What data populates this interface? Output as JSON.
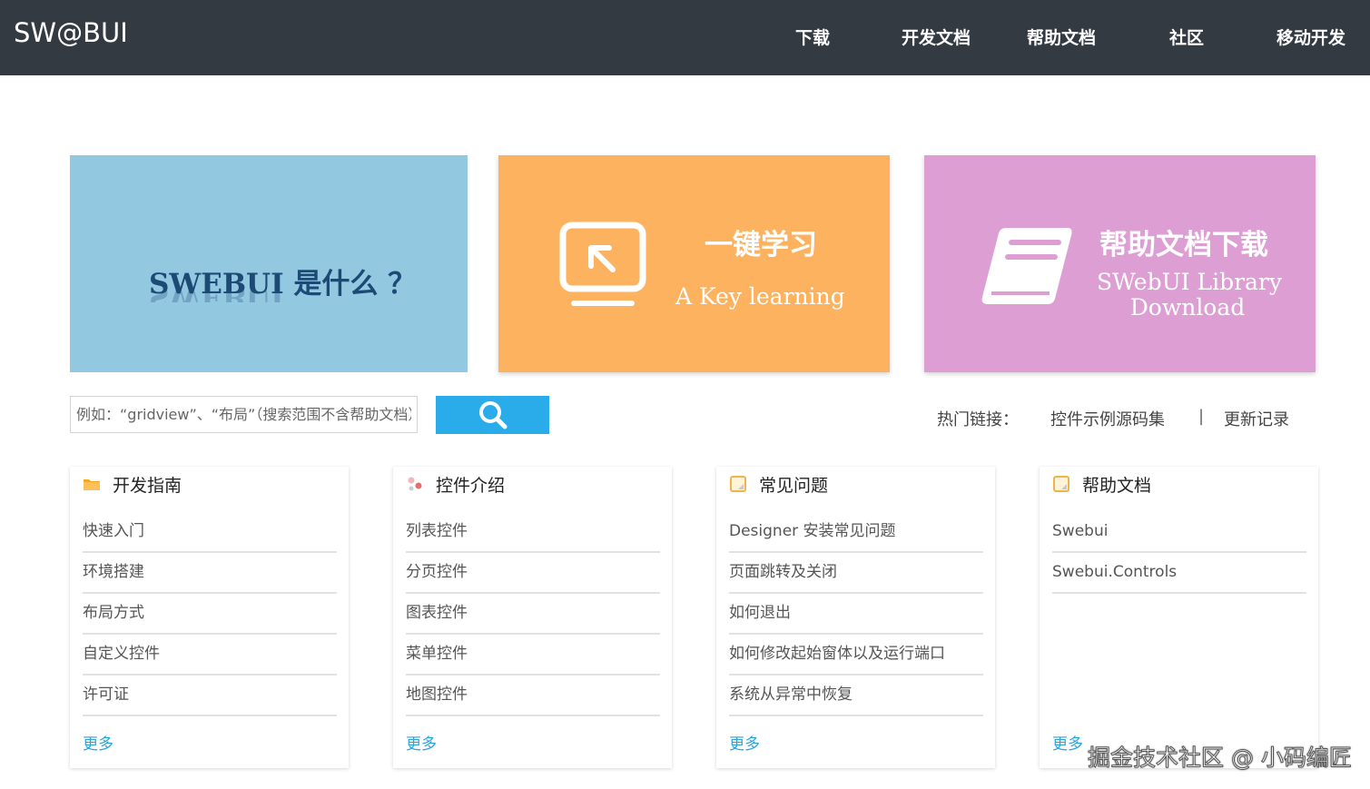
{
  "brand": {
    "logo_text": "SW@BUI"
  },
  "nav": {
    "items": [
      "下载",
      "开发文档",
      "帮助文档",
      "社区",
      "移动开发"
    ]
  },
  "banners": {
    "what": {
      "title": "SWEBUI 是什么 ？",
      "reflection": "SWEBUI"
    },
    "learn": {
      "title": "一键学习",
      "subtitle": "A Key learning",
      "icon": "screen-arrow-icon"
    },
    "help": {
      "title": "帮助文档下载",
      "subtitle_line1": "SWebUI Library",
      "subtitle_line2": "Download",
      "icon": "book-icon"
    }
  },
  "search": {
    "placeholder": "例如：“gridview”、“布局”（搜索范围不含帮助文档）",
    "button_icon": "search-icon"
  },
  "hot_links": {
    "label": "热门链接：",
    "items": [
      "控件示例源码集",
      "更新记录"
    ],
    "separator": "|"
  },
  "cards": [
    {
      "title": "开发指南",
      "icon": "folder-icon",
      "items": [
        "快速入门",
        "环境搭建",
        "布局方式",
        "自定义控件",
        "许可证"
      ],
      "more": "更多"
    },
    {
      "title": "控件介绍",
      "icon": "components-icon",
      "items": [
        "列表控件",
        "分页控件",
        "图表控件",
        "菜单控件",
        "地图控件"
      ],
      "more": "更多"
    },
    {
      "title": "常见问题",
      "icon": "document-icon",
      "items": [
        "Designer 安装常见问题",
        "页面跳转及关闭",
        "如何退出",
        "如何修改起始窗体以及运行端口",
        "系统从异常中恢复"
      ],
      "more": "更多"
    },
    {
      "title": "帮助文档",
      "icon": "document-icon",
      "items": [
        "Swebui",
        "Swebui.Controls"
      ],
      "more": "更多"
    }
  ],
  "watermark": "掘金技术社区 @ 小码编匠",
  "colors": {
    "topbar": "#343a42",
    "banner_blue": "#93c8e1",
    "banner_orange": "#fdb25f",
    "banner_pink": "#dd9fd3",
    "accent": "#2aabea"
  }
}
